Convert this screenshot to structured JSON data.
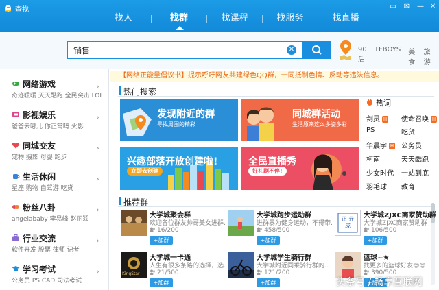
{
  "window": {
    "title": "查找"
  },
  "tabs": [
    {
      "label": "找人"
    },
    {
      "label": "找群"
    },
    {
      "label": "找课程"
    },
    {
      "label": "找服务"
    },
    {
      "label": "找直播"
    }
  ],
  "search": {
    "value": "销售"
  },
  "hot_tags": [
    "90后",
    "TFBOYS",
    "美食",
    "旅游"
  ],
  "notice": "【网络正能量倡议书】提示呼吁网友共建绿色QQ群，一同抵制色情、反动等违法信息。",
  "sidebar": {
    "items": [
      {
        "title": "网络游戏",
        "sub": "奇迹暖暖  天天酷跑  全民突击  LOL"
      },
      {
        "title": "影视娱乐",
        "sub": "爸爸去哪儿  你正常吗  火影"
      },
      {
        "title": "同城交友",
        "sub": "宠物  摄影  母婴  跑步"
      },
      {
        "title": "生活休闲",
        "sub": "星座  购物  自驾游  吃货"
      },
      {
        "title": "粉丝八卦",
        "sub": "angelababy  李易峰  赵丽颖"
      },
      {
        "title": "行业交流",
        "sub": "软件开发  股票  律师  记者"
      },
      {
        "title": "学习考试",
        "sub": "公务员  PS  CAD  司法考试"
      }
    ]
  },
  "hot_search": {
    "title": "热门搜索",
    "banners": [
      {
        "title": "发现附近的群",
        "sub": "寻找周围的精彩"
      },
      {
        "title": "同城群活动",
        "sub": "生活原来这么多姿多彩"
      },
      {
        "title": "兴趣部落开放创建啦!",
        "sub": "立即去创建"
      },
      {
        "title": "全民直播秀",
        "sub": "好礼刷不停!"
      }
    ]
  },
  "hotwords": {
    "title": "热词",
    "badge": "H",
    "items": [
      "剑灵",
      "使命召唤",
      "PS",
      "吃货",
      "华晨宇",
      "公务员",
      "柯南",
      "天天酷跑",
      "少女时代",
      "一站到底",
      "羽毛球",
      "教育"
    ]
  },
  "recommend": {
    "title": "推荐群",
    "add_label": "+加群",
    "groups": [
      {
        "name": "大学城聚会群",
        "desc": "欢迎各位群友帅哥美女进群...",
        "count": "16/200"
      },
      {
        "name": "大学城跑步运动群",
        "desc": "进群暴为健身运动，不得带...",
        "count": "458/500"
      },
      {
        "name": "大学城ZJXC商家赞助群",
        "desc": "大学城ZJXC商家赞助群",
        "count": "106/500"
      },
      {
        "name": "大学城一卡通",
        "desc": "人生有很多条路的选择，选...",
        "count": "21/500"
      },
      {
        "name": "大学城学生骑行群",
        "desc": "大学城附近同乘骑行群的...",
        "count": "121/200"
      },
      {
        "name": "大学城羽毛篮球",
        "desc": "大学城附近羽毛篮球",
        "count": "43/200"
      },
      {
        "name": "篮球~★",
        "desc": "找更多的篮球好友😊😊",
        "count": "390/500"
      }
    ]
  },
  "thumb_text": {
    "seal": "正 亓 成",
    "kingstar": "KingStar"
  },
  "watermark": "头条号 / 畅享互联网",
  "colors": {
    "brand": "#1a8fe0",
    "notice": "#e86a1a",
    "badge": "#f36c21"
  }
}
